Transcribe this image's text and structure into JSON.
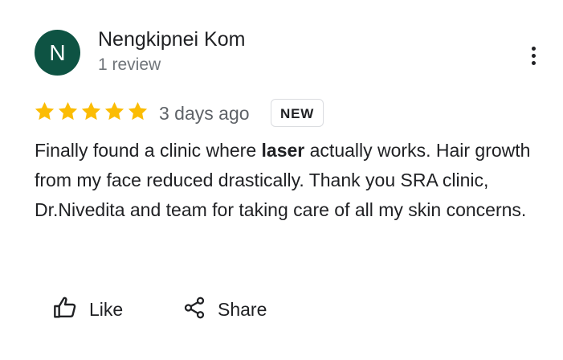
{
  "reviewer": {
    "avatar_letter": "N",
    "avatar_color": "#0e5343",
    "name": "Nengkipnei Kom",
    "review_count": "1 review"
  },
  "menu": {
    "icon": "more-vert-icon"
  },
  "rating": {
    "stars": 5,
    "max_stars": 5,
    "star_color": "#fbbc04",
    "time_ago": "3 days ago",
    "badge": "NEW"
  },
  "review": {
    "text_before": "Finally found a clinic where ",
    "highlight": "laser",
    "text_after": " actually works. Hair growth from my face reduced drastically. Thank you SRA clinic, Dr.Nivedita and team for taking care of all my skin concerns."
  },
  "actions": {
    "like_label": "Like",
    "like_icon": "thumb-up-icon",
    "share_label": "Share",
    "share_icon": "share-icon"
  }
}
